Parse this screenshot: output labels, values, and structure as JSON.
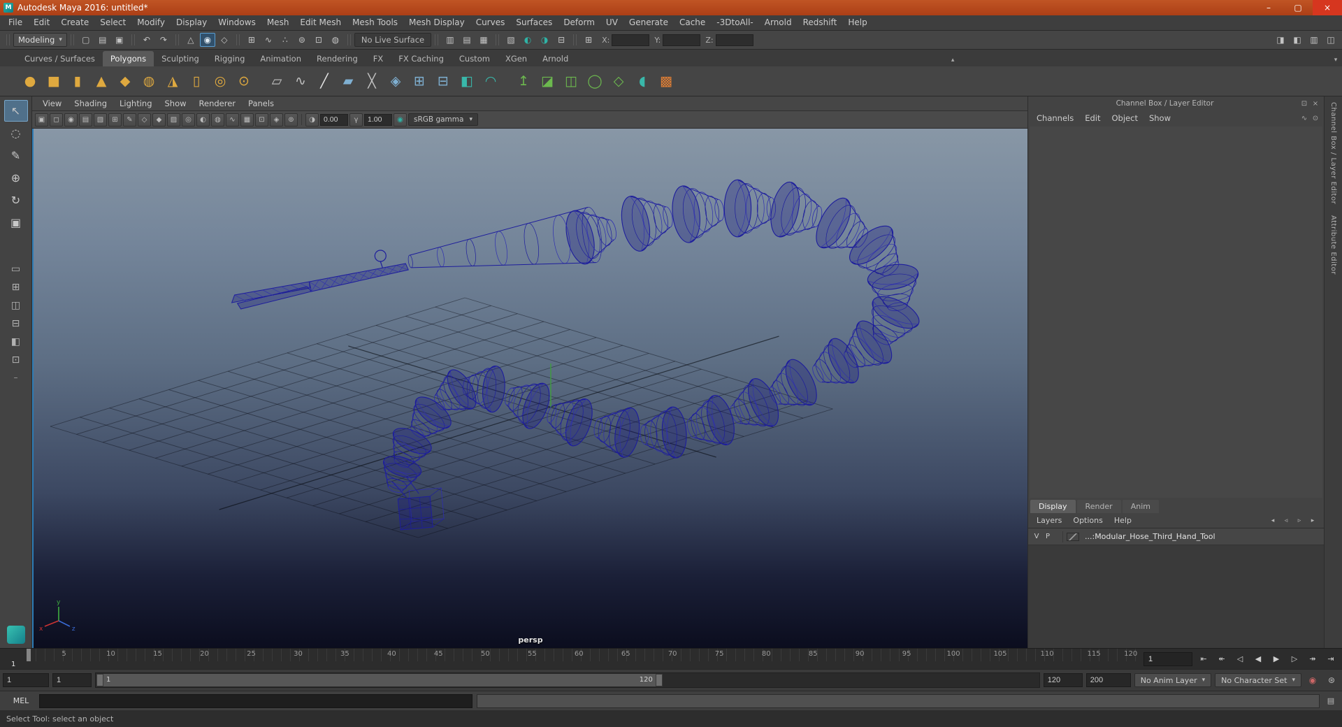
{
  "window": {
    "title": "Autodesk Maya 2016: untitled*",
    "minimize": "–",
    "maximize": "▢",
    "close": "×"
  },
  "menubar": {
    "items": [
      "File",
      "Edit",
      "Create",
      "Select",
      "Modify",
      "Display",
      "Windows",
      "Mesh",
      "Edit Mesh",
      "Mesh Tools",
      "Mesh Display",
      "Curves",
      "Surfaces",
      "Deform",
      "UV",
      "Generate",
      "Cache",
      "-3DtoAll-",
      "Arnold",
      "Redshift",
      "Help"
    ]
  },
  "statusline": {
    "menu_set": "Modeling",
    "live_surface": "No Live Surface",
    "x_label": "X:",
    "y_label": "Y:",
    "z_label": "Z:",
    "coord_icon": "⊞",
    "file_icons": [
      {
        "name": "new-scene-icon",
        "glyph": "▢"
      },
      {
        "name": "open-scene-icon",
        "glyph": "▤"
      },
      {
        "name": "save-scene-icon",
        "glyph": "▣"
      }
    ],
    "undo_icons": [
      {
        "name": "undo-icon",
        "glyph": "↶"
      },
      {
        "name": "redo-icon",
        "glyph": "↷"
      }
    ],
    "mask_icons": [
      {
        "name": "select-by-hierarchy-icon",
        "glyph": "△"
      },
      {
        "name": "select-by-object-icon",
        "glyph": "◉",
        "active": true
      },
      {
        "name": "select-by-component-icon",
        "glyph": "◇"
      }
    ],
    "snap_icons": [
      {
        "name": "snap-to-grids-icon",
        "glyph": "⊞"
      },
      {
        "name": "snap-to-curves-icon",
        "glyph": "∿"
      },
      {
        "name": "snap-to-points-icon",
        "glyph": "∴"
      },
      {
        "name": "snap-to-projected-center-icon",
        "glyph": "⊚"
      },
      {
        "name": "snap-to-view-planes-icon",
        "glyph": "⊡"
      },
      {
        "name": "make-live-icon",
        "glyph": "◍"
      }
    ],
    "history_icons": [
      {
        "name": "input-connections-icon",
        "glyph": "▥"
      },
      {
        "name": "output-connections-icon",
        "glyph": "▤"
      },
      {
        "name": "construction-history-icon",
        "glyph": "▦"
      }
    ],
    "render_icons": [
      {
        "name": "open-render-view-icon",
        "glyph": "▧"
      },
      {
        "name": "render-current-frame-icon",
        "glyph": "◐",
        "cls": "teal"
      },
      {
        "name": "ipr-render-icon",
        "glyph": "◑",
        "cls": "teal"
      },
      {
        "name": "render-settings-icon",
        "glyph": "⊟"
      }
    ],
    "right_icons": [
      {
        "name": "toggle-modeling-toolkit-icon",
        "glyph": "◨"
      },
      {
        "name": "toggle-attribute-editor-icon",
        "glyph": "◧"
      },
      {
        "name": "toggle-tool-settings-icon",
        "glyph": "▥"
      },
      {
        "name": "toggle-channel-box-icon",
        "glyph": "◫"
      }
    ]
  },
  "shelf": {
    "tabs": [
      {
        "label": "Curves / Surfaces",
        "name": "shelf-tab-curves-surfaces"
      },
      {
        "label": "Polygons",
        "name": "shelf-tab-polygons",
        "active": true
      },
      {
        "label": "Sculpting",
        "name": "shelf-tab-sculpting"
      },
      {
        "label": "Rigging",
        "name": "shelf-tab-rigging"
      },
      {
        "label": "Animation",
        "name": "shelf-tab-animation"
      },
      {
        "label": "Rendering",
        "name": "shelf-tab-rendering"
      },
      {
        "label": "FX",
        "name": "shelf-tab-fx"
      },
      {
        "label": "FX Caching",
        "name": "shelf-tab-fx-caching"
      },
      {
        "label": "Custom",
        "name": "shelf-tab-custom"
      },
      {
        "label": "XGen",
        "name": "shelf-tab-xgen"
      },
      {
        "label": "Arnold",
        "name": "shelf-tab-arnold"
      }
    ],
    "tab_up_icon": "▴",
    "tab_menu_icon": "▾",
    "icons": [
      {
        "name": "shelf-poly-sphere-icon",
        "glyph": "●",
        "cls": "gold"
      },
      {
        "name": "shelf-poly-cube-icon",
        "glyph": "■",
        "cls": "gold"
      },
      {
        "name": "shelf-poly-cylinder-icon",
        "glyph": "▮",
        "cls": "gold"
      },
      {
        "name": "shelf-poly-cone-icon",
        "glyph": "▲",
        "cls": "gold"
      },
      {
        "name": "shelf-poly-platonic-icon",
        "glyph": "◆",
        "cls": "gold"
      },
      {
        "name": "shelf-poly-helix-icon",
        "glyph": "◍",
        "cls": "gold"
      },
      {
        "name": "shelf-poly-pyramid-icon",
        "glyph": "◮",
        "cls": "gold"
      },
      {
        "name": "shelf-poly-pipe-icon",
        "glyph": "▯",
        "cls": "gold"
      },
      {
        "name": "shelf-poly-torus-icon",
        "glyph": "◎",
        "cls": "gold"
      },
      {
        "name": "shelf-poly-disc-icon",
        "glyph": "⊙",
        "cls": "gold"
      },
      {
        "name": "shelf-type-tool-icon",
        "glyph": "▱",
        "cls": "gray gap"
      },
      {
        "name": "shelf-sweep-mesh-icon",
        "glyph": "∿",
        "cls": "gray"
      },
      {
        "name": "shelf-pencil-curve-icon",
        "glyph": "╱",
        "cls": "white"
      },
      {
        "name": "shelf-quad-draw-icon",
        "glyph": "▰",
        "cls": "blue"
      },
      {
        "name": "shelf-multi-cut-icon",
        "glyph": "╳",
        "cls": "gray"
      },
      {
        "name": "shelf-target-weld-icon",
        "glyph": "◈",
        "cls": "blue"
      },
      {
        "name": "shelf-combine-icon",
        "glyph": "⊞",
        "cls": "blue"
      },
      {
        "name": "shelf-separate-icon",
        "glyph": "⊟",
        "cls": "blue"
      },
      {
        "name": "shelf-mirror-icon",
        "glyph": "◧",
        "cls": "teal"
      },
      {
        "name": "shelf-smooth-icon",
        "glyph": "◠",
        "cls": "teal"
      },
      {
        "name": "shelf-extrude-icon",
        "glyph": "↥",
        "cls": "green gap"
      },
      {
        "name": "shelf-bevel-icon",
        "glyph": "◪",
        "cls": "green"
      },
      {
        "name": "shelf-bridge-icon",
        "glyph": "◫",
        "cls": "green"
      },
      {
        "name": "shelf-fill-hole-icon",
        "glyph": "◯",
        "cls": "green"
      },
      {
        "name": "shelf-append-polygon-icon",
        "glyph": "◇",
        "cls": "green"
      },
      {
        "name": "shelf-sculpt-tool-icon",
        "glyph": "◖",
        "cls": "teal"
      },
      {
        "name": "shelf-lattice-icon",
        "glyph": "▩",
        "cls": "orange"
      }
    ]
  },
  "toolbox": {
    "tools": [
      {
        "name": "select-tool",
        "glyph": "↖",
        "active": true
      },
      {
        "name": "lasso-tool",
        "glyph": "◌"
      },
      {
        "name": "paint-select-tool",
        "glyph": "✎"
      },
      {
        "name": "move-tool",
        "glyph": "⊕"
      },
      {
        "name": "rotate-tool",
        "glyph": "↻"
      },
      {
        "name": "scale-tool",
        "glyph": "▣"
      }
    ],
    "layouts": [
      {
        "name": "layout-single-pane",
        "glyph": "▭"
      },
      {
        "name": "layout-four-pane",
        "glyph": "⊞"
      },
      {
        "name": "layout-two-pane-side",
        "glyph": "◫"
      },
      {
        "name": "layout-two-pane-stacked",
        "glyph": "⊟"
      },
      {
        "name": "layout-persp-outliner",
        "glyph": "◧"
      },
      {
        "name": "layout-hypershade",
        "glyph": "⊡"
      }
    ],
    "collapse": "–"
  },
  "viewport": {
    "menus": [
      "View",
      "Shading",
      "Lighting",
      "Show",
      "Renderer",
      "Panels"
    ],
    "toolbar_icons": [
      {
        "name": "viewport-select-camera-icon",
        "glyph": "▣"
      },
      {
        "name": "viewport-lock-camera-icon",
        "glyph": "◻"
      },
      {
        "name": "viewport-camera-attributes-icon",
        "glyph": "◉"
      },
      {
        "name": "viewport-bookmarks-icon",
        "glyph": "▤"
      },
      {
        "name": "viewport-image-plane-icon",
        "glyph": "▧"
      },
      {
        "name": "viewport-2d-pan-zoom-icon",
        "glyph": "⊞"
      },
      {
        "name": "viewport-grease-pencil-icon",
        "glyph": "✎"
      },
      {
        "name": "viewport-wireframe-icon",
        "glyph": "◇"
      },
      {
        "name": "viewport-smooth-shade-icon",
        "glyph": "◆"
      },
      {
        "name": "viewport-textured-icon",
        "glyph": "▨"
      },
      {
        "name": "viewport-use-all-lights-icon",
        "glyph": "◎"
      },
      {
        "name": "viewport-shadows-icon",
        "glyph": "◐"
      },
      {
        "name": "viewport-screen-space-ao-icon",
        "glyph": "◍"
      },
      {
        "name": "viewport-motion-blur-icon",
        "glyph": "∿"
      },
      {
        "name": "viewport-multisample-icon",
        "glyph": "▦"
      },
      {
        "name": "viewport-isolate-select-icon",
        "glyph": "⊡"
      },
      {
        "name": "viewport-xray-icon",
        "glyph": "◈"
      },
      {
        "name": "viewport-joints-xray-icon",
        "glyph": "⊚"
      }
    ],
    "exposure_icon": "◑",
    "exposure": "0.00",
    "gamma_icon": "γ",
    "gamma": "1.00",
    "color_mgmt_icon": "◉",
    "view_transform": "sRGB gamma",
    "camera": "persp"
  },
  "channelbox": {
    "title": "Channel Box / Layer Editor",
    "header_icons": [
      {
        "name": "float-panel-icon",
        "glyph": "⊡"
      },
      {
        "name": "close-panel-icon",
        "glyph": "×"
      }
    ],
    "menus": [
      "Channels",
      "Edit",
      "Object",
      "Show"
    ],
    "menu_icons": [
      {
        "name": "channel-speed-icon",
        "glyph": "∿"
      },
      {
        "name": "pin-icon",
        "glyph": "⊙"
      }
    ],
    "editor_tabs": [
      {
        "label": "Display",
        "name": "layer-tab-display",
        "active": true
      },
      {
        "label": "Render",
        "name": "layer-tab-render"
      },
      {
        "label": "Anim",
        "name": "layer-tab-anim"
      }
    ],
    "editor_menus": [
      "Layers",
      "Options",
      "Help"
    ],
    "editor_icons": [
      {
        "name": "layer-toolbar-icon-1",
        "glyph": "◂"
      },
      {
        "name": "layer-toolbar-icon-2",
        "glyph": "◃"
      },
      {
        "name": "layer-toolbar-icon-3",
        "glyph": "▹"
      },
      {
        "name": "layer-toolbar-icon-4",
        "glyph": "▸"
      }
    ],
    "layer": {
      "visible": "V",
      "playback": "P",
      "layer_name": "...:Modular_Hose_Third_Hand_Tool"
    }
  },
  "sidestrip": {
    "tabs": [
      {
        "label": "Channel Box / Layer Editor",
        "name": "side-tab-channel-box"
      },
      {
        "label": "Attribute Editor",
        "name": "side-tab-attribute-editor"
      }
    ]
  },
  "timeslider": {
    "start_label": "1",
    "current_frame": "1",
    "ticks": [
      {
        "label": "5",
        "left": "3.36%"
      },
      {
        "label": "10",
        "left": "7.56%"
      },
      {
        "label": "15",
        "left": "11.76%"
      },
      {
        "label": "20",
        "left": "15.97%"
      },
      {
        "label": "25",
        "left": "20.17%"
      },
      {
        "label": "30",
        "left": "24.37%"
      },
      {
        "label": "35",
        "left": "28.57%"
      },
      {
        "label": "40",
        "left": "32.77%"
      },
      {
        "label": "45",
        "left": "36.97%"
      },
      {
        "label": "50",
        "left": "41.18%"
      },
      {
        "label": "55",
        "left": "45.38%"
      },
      {
        "label": "60",
        "left": "49.58%"
      },
      {
        "label": "65",
        "left": "53.78%"
      },
      {
        "label": "70",
        "left": "57.98%"
      },
      {
        "label": "75",
        "left": "62.18%"
      },
      {
        "label": "80",
        "left": "66.39%"
      },
      {
        "label": "85",
        "left": "70.59%"
      },
      {
        "label": "90",
        "left": "74.79%"
      },
      {
        "label": "95",
        "left": "78.99%"
      },
      {
        "label": "100",
        "left": "83.19%"
      },
      {
        "label": "105",
        "left": "87.39%"
      },
      {
        "label": "110",
        "left": "91.6%"
      },
      {
        "label": "115",
        "left": "95.8%"
      },
      {
        "label": "120",
        "left": "99.1%"
      }
    ],
    "playback": [
      {
        "name": "go-to-start-button",
        "glyph": "⇤"
      },
      {
        "name": "step-back-key-button",
        "glyph": "↞"
      },
      {
        "name": "step-back-frame-button",
        "glyph": "◁"
      },
      {
        "name": "play-backwards-button",
        "glyph": "◀"
      },
      {
        "name": "play-forwards-button",
        "glyph": "▶"
      },
      {
        "name": "step-forward-frame-button",
        "glyph": "▷"
      },
      {
        "name": "step-forward-key-button",
        "glyph": "↠"
      },
      {
        "name": "go-to-end-button",
        "glyph": "⇥"
      }
    ]
  },
  "rangeslider": {
    "anim_start": "1",
    "playback_start": "1",
    "bar_start_label": "1",
    "bar_end_label": "120",
    "playback_end": "120",
    "anim_end": "200",
    "anim_layer": "No Anim Layer",
    "character_set": "No Character Set",
    "auto_key_icon": "◉",
    "prefs_icon": "⊛"
  },
  "commandline": {
    "label": "MEL",
    "script_editor_icon": "▤"
  },
  "helpline": {
    "text": "Select Tool: select an object"
  }
}
